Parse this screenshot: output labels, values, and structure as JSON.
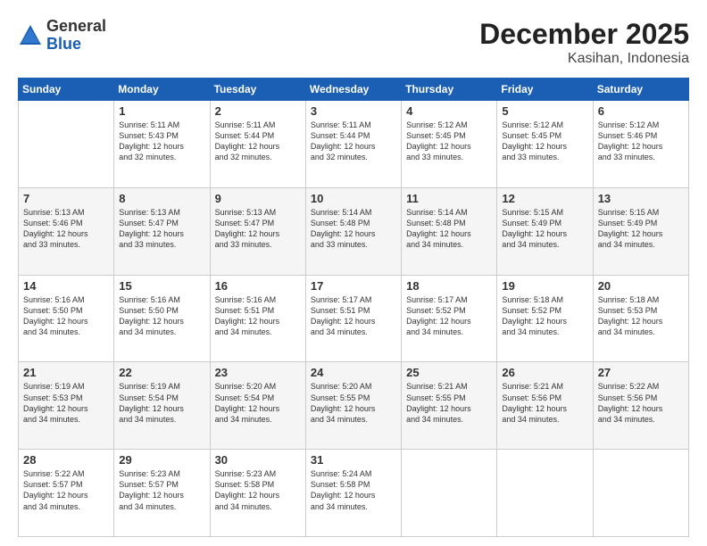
{
  "header": {
    "logo_general": "General",
    "logo_blue": "Blue",
    "month_title": "December 2025",
    "location": "Kasihan, Indonesia"
  },
  "weekdays": [
    "Sunday",
    "Monday",
    "Tuesday",
    "Wednesday",
    "Thursday",
    "Friday",
    "Saturday"
  ],
  "rows": [
    [
      {
        "day": "",
        "empty": true
      },
      {
        "day": "1",
        "sunrise": "5:11 AM",
        "sunset": "5:43 PM",
        "daylight": "12 hours and 32 minutes."
      },
      {
        "day": "2",
        "sunrise": "5:11 AM",
        "sunset": "5:44 PM",
        "daylight": "12 hours and 32 minutes."
      },
      {
        "day": "3",
        "sunrise": "5:11 AM",
        "sunset": "5:44 PM",
        "daylight": "12 hours and 32 minutes."
      },
      {
        "day": "4",
        "sunrise": "5:12 AM",
        "sunset": "5:45 PM",
        "daylight": "12 hours and 33 minutes."
      },
      {
        "day": "5",
        "sunrise": "5:12 AM",
        "sunset": "5:45 PM",
        "daylight": "12 hours and 33 minutes."
      },
      {
        "day": "6",
        "sunrise": "5:12 AM",
        "sunset": "5:46 PM",
        "daylight": "12 hours and 33 minutes."
      }
    ],
    [
      {
        "day": "7",
        "sunrise": "5:13 AM",
        "sunset": "5:46 PM",
        "daylight": "12 hours and 33 minutes."
      },
      {
        "day": "8",
        "sunrise": "5:13 AM",
        "sunset": "5:47 PM",
        "daylight": "12 hours and 33 minutes."
      },
      {
        "day": "9",
        "sunrise": "5:13 AM",
        "sunset": "5:47 PM",
        "daylight": "12 hours and 33 minutes."
      },
      {
        "day": "10",
        "sunrise": "5:14 AM",
        "sunset": "5:48 PM",
        "daylight": "12 hours and 33 minutes."
      },
      {
        "day": "11",
        "sunrise": "5:14 AM",
        "sunset": "5:48 PM",
        "daylight": "12 hours and 34 minutes."
      },
      {
        "day": "12",
        "sunrise": "5:15 AM",
        "sunset": "5:49 PM",
        "daylight": "12 hours and 34 minutes."
      },
      {
        "day": "13",
        "sunrise": "5:15 AM",
        "sunset": "5:49 PM",
        "daylight": "12 hours and 34 minutes."
      }
    ],
    [
      {
        "day": "14",
        "sunrise": "5:16 AM",
        "sunset": "5:50 PM",
        "daylight": "12 hours and 34 minutes."
      },
      {
        "day": "15",
        "sunrise": "5:16 AM",
        "sunset": "5:50 PM",
        "daylight": "12 hours and 34 minutes."
      },
      {
        "day": "16",
        "sunrise": "5:16 AM",
        "sunset": "5:51 PM",
        "daylight": "12 hours and 34 minutes."
      },
      {
        "day": "17",
        "sunrise": "5:17 AM",
        "sunset": "5:51 PM",
        "daylight": "12 hours and 34 minutes."
      },
      {
        "day": "18",
        "sunrise": "5:17 AM",
        "sunset": "5:52 PM",
        "daylight": "12 hours and 34 minutes."
      },
      {
        "day": "19",
        "sunrise": "5:18 AM",
        "sunset": "5:52 PM",
        "daylight": "12 hours and 34 minutes."
      },
      {
        "day": "20",
        "sunrise": "5:18 AM",
        "sunset": "5:53 PM",
        "daylight": "12 hours and 34 minutes."
      }
    ],
    [
      {
        "day": "21",
        "sunrise": "5:19 AM",
        "sunset": "5:53 PM",
        "daylight": "12 hours and 34 minutes."
      },
      {
        "day": "22",
        "sunrise": "5:19 AM",
        "sunset": "5:54 PM",
        "daylight": "12 hours and 34 minutes."
      },
      {
        "day": "23",
        "sunrise": "5:20 AM",
        "sunset": "5:54 PM",
        "daylight": "12 hours and 34 minutes."
      },
      {
        "day": "24",
        "sunrise": "5:20 AM",
        "sunset": "5:55 PM",
        "daylight": "12 hours and 34 minutes."
      },
      {
        "day": "25",
        "sunrise": "5:21 AM",
        "sunset": "5:55 PM",
        "daylight": "12 hours and 34 minutes."
      },
      {
        "day": "26",
        "sunrise": "5:21 AM",
        "sunset": "5:56 PM",
        "daylight": "12 hours and 34 minutes."
      },
      {
        "day": "27",
        "sunrise": "5:22 AM",
        "sunset": "5:56 PM",
        "daylight": "12 hours and 34 minutes."
      }
    ],
    [
      {
        "day": "28",
        "sunrise": "5:22 AM",
        "sunset": "5:57 PM",
        "daylight": "12 hours and 34 minutes."
      },
      {
        "day": "29",
        "sunrise": "5:23 AM",
        "sunset": "5:57 PM",
        "daylight": "12 hours and 34 minutes."
      },
      {
        "day": "30",
        "sunrise": "5:23 AM",
        "sunset": "5:58 PM",
        "daylight": "12 hours and 34 minutes."
      },
      {
        "day": "31",
        "sunrise": "5:24 AM",
        "sunset": "5:58 PM",
        "daylight": "12 hours and 34 minutes."
      },
      {
        "day": "",
        "empty": true
      },
      {
        "day": "",
        "empty": true
      },
      {
        "day": "",
        "empty": true
      }
    ]
  ],
  "labels": {
    "sunrise": "Sunrise:",
    "sunset": "Sunset:",
    "daylight": "Daylight:"
  }
}
